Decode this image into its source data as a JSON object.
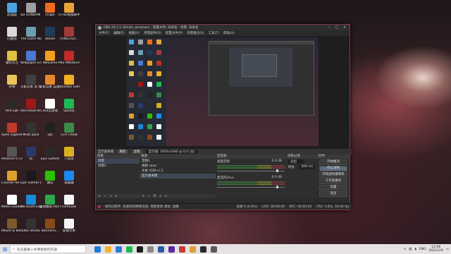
{
  "desktop": {
    "icons": [
      {
        "label": "此电脑",
        "color": "#4ba3e6"
      },
      {
        "label": "SD GUNDAM ...",
        "color": "#a0a0a0"
      },
      {
        "label": "Origin",
        "color": "#f26a1b"
      },
      {
        "label": "CFHD客服助手",
        "color": "#e8a33a"
      },
      {
        "label": "回收站",
        "color": "#d9d9d9"
      },
      {
        "label": "The Outer Worlds",
        "color": "#6aa0b0"
      },
      {
        "label": "Steam",
        "color": "#1f3b5a"
      },
      {
        "label": "FUNGrisur...",
        "color": "#a33a3a"
      },
      {
        "label": "爆炸大吉",
        "color": "#e0c040"
      },
      {
        "label": "Wallpaper Engine ...",
        "color": "#4a7ad0"
      },
      {
        "label": "WeGame",
        "color": "#f0a020"
      },
      {
        "label": "MSI Afterburner",
        "color": "#c02a2a"
      },
      {
        "label": "杂物",
        "color": "#e8c65a"
      },
      {
        "label": "火影忍者 黑 魂",
        "color": "#404040"
      },
      {
        "label": "火影忍者 自定义版",
        "color": "#e38a2a"
      },
      {
        "label": "Rockstar Games...",
        "color": "#f0b020"
      },
      {
        "label": "Ann Lab",
        "color": "#2a2a2a"
      },
      {
        "label": "Red Dead Redempti...",
        "color": "#a01818"
      },
      {
        "label": "163云游戏",
        "color": "#ffffff"
      },
      {
        "label": "Spotify",
        "color": "#1db954"
      },
      {
        "label": "Apex Legends",
        "color": "#c0392b"
      },
      {
        "label": "MOD pack",
        "color": "#333333"
      },
      {
        "label": "QQ",
        "color": "#222222"
      },
      {
        "label": "GTA Cheat",
        "color": "#3a8a4a"
      },
      {
        "label": "Assassin's Creed V...",
        "color": "#555555"
      },
      {
        "label": "SE",
        "color": "#2a3a6a"
      },
      {
        "label": "Epic Games",
        "color": "#2a2a2a"
      },
      {
        "label": "八选卷",
        "color": "#d8b020"
      },
      {
        "label": "Counter-Str... Global Off...",
        "color": "#e0a030"
      },
      {
        "label": "Epic Games Launcher",
        "color": "#1a1a1a"
      },
      {
        "label": "微信",
        "color": "#2dc100"
      },
      {
        "label": "加速器",
        "color": "#1a8af0"
      },
      {
        "label": "Metro Exodus",
        "color": "#ffffff"
      },
      {
        "label": "Microsoft Edge",
        "color": "#1a8ad8"
      },
      {
        "label": "战地模组 Hot Kingdom",
        "color": "#2aa84a"
      },
      {
        "label": "Formulas",
        "color": "#f4f4f4"
      },
      {
        "label": "Mount & Blade II...",
        "color": "#7a5a2a"
      },
      {
        "label": "OBS Studio",
        "color": "#333333"
      },
      {
        "label": "Bannerlo...",
        "color": "#8a4a1a"
      },
      {
        "label": "新建文本",
        "color": "#f4f4f4"
      }
    ]
  },
  "obs": {
    "title": "OBS 26.1.1 (64-bit, windows) - 配置文件: 未命名 - 场景: 未命名",
    "window_controls": [
      "–",
      "□",
      "✕"
    ],
    "menu": [
      "文件(F)",
      "编辑(E)",
      "视图(V)",
      "停靠部件(D)",
      "配置文件(P)",
      "场景集合(S)",
      "工具(T)",
      "帮助(H)"
    ],
    "source_bar": {
      "label": "显示器采集",
      "properties": "属性",
      "filters": "滤镜",
      "display_value": "显示器: 1920x1080 @ 0,0 (主)"
    },
    "docks": {
      "scenes": {
        "header": "场景",
        "items": [
          "场景",
          "场景2"
        ]
      },
      "sources": {
        "header": "来源",
        "items": [
          "音频1",
          "视频 save",
          "文本 (GDI+) 2",
          "显示器采集"
        ]
      },
      "mixer": {
        "header": "混音器",
        "channels": [
          {
            "name": "桌面音频",
            "db": "0.0 dB"
          },
          {
            "name": "麦克风/Aux",
            "db": "0.0 dB"
          }
        ]
      },
      "transitions": {
        "header": "场景过渡",
        "type_label": "淡出",
        "duration_label": "时长",
        "duration_value": "300 ms"
      },
      "controls": {
        "header": "控件",
        "buttons": [
          "开始推流",
          "停止录制",
          "开始虚拟摄像机",
          "工作室模式",
          "设置",
          "退出"
        ]
      },
      "add": "+",
      "remove": "−",
      "settings": "⚙",
      "up": "∧",
      "down": "∨"
    },
    "status": {
      "warning": "新的已断开: 检查你的网络连接, 或者更改 调试: 直播",
      "dropped": "丢帧 0 (0.0%)",
      "live": "LIVE: 00:00:00",
      "rec": "REC: 00:00:05",
      "cpu": "CPU: 3.8%, 30.00 fps"
    }
  },
  "taskbar": {
    "start_icon": "windows-logo-icon",
    "search_placeholder": "在这里输入你要搜索的内容",
    "app_colors": [
      "#1e7ad8",
      "#f2b32a",
      "#2a7ad8",
      "#1db954",
      "#1a1a1a",
      "#8a8a8a",
      "#2a5aa8",
      "#5a2aa8",
      "#c83a3a",
      "#e0a030",
      "#2a2a2a",
      "#5a5a5a"
    ],
    "tray": {
      "language": "ENG",
      "time": "12:08",
      "date": "2021/1/6"
    }
  }
}
